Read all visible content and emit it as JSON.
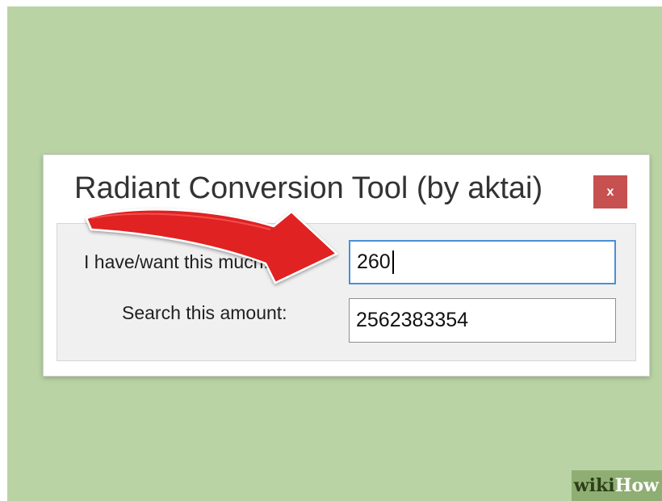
{
  "dialog": {
    "title": "Radiant Conversion Tool (by aktai)",
    "close_label": "x",
    "close_color": "#c75050"
  },
  "fields": {
    "have_label": "I have/want this much:",
    "have_value": "260",
    "search_label": "Search this amount:",
    "search_value": "2562383354"
  },
  "annotation": {
    "arrow_color": "#e02020",
    "arrow_icon": "red-arrow-icon"
  },
  "watermark": {
    "wiki": "wiki",
    "how": "How"
  },
  "colors": {
    "background": "#b9d3a4",
    "focus_border": "#4a8fd8"
  }
}
